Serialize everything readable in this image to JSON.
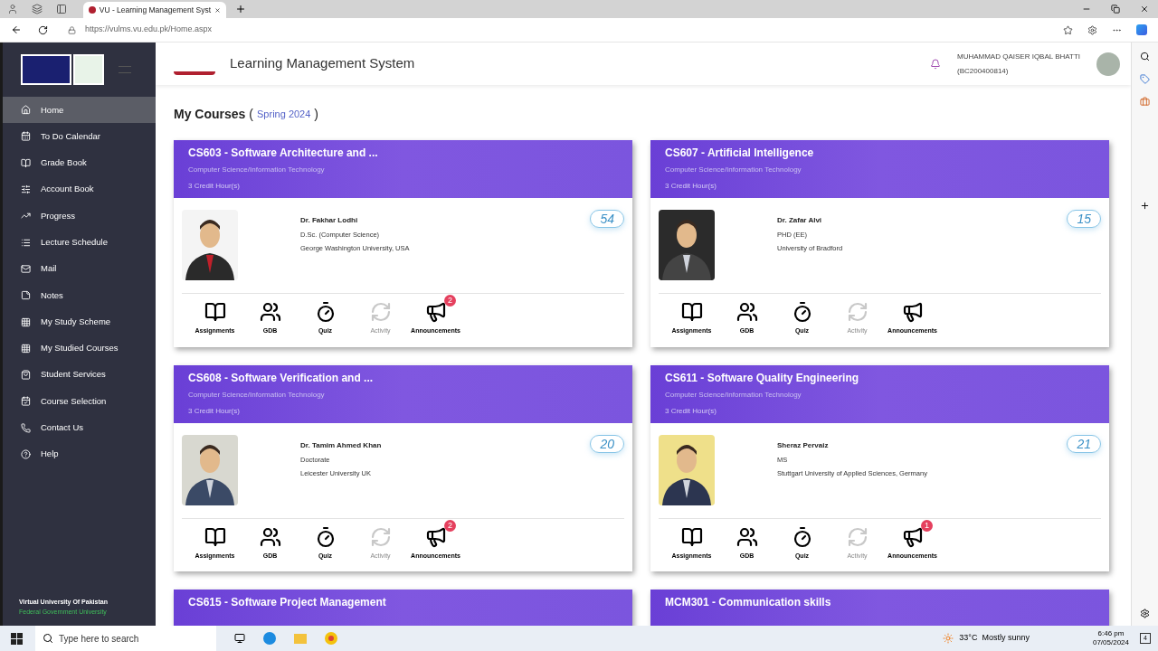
{
  "browser": {
    "tab": {
      "title": "VU - Learning Management Syst"
    },
    "url": "https://vulms.vu.edu.pk/Home.aspx"
  },
  "sidebar": {
    "items": [
      {
        "label": "Home",
        "selected": true
      },
      {
        "label": "To Do Calendar",
        "selected": false
      },
      {
        "label": "Grade Book",
        "selected": false
      },
      {
        "label": "Account Book",
        "selected": false
      },
      {
        "label": "Progress",
        "selected": false
      },
      {
        "label": "Lecture Schedule",
        "selected": false
      },
      {
        "label": "Mail",
        "selected": false
      },
      {
        "label": "Notes",
        "selected": false
      },
      {
        "label": "My Study Scheme",
        "selected": false
      },
      {
        "label": "My Studied Courses",
        "selected": false
      },
      {
        "label": "Student Services",
        "selected": false
      },
      {
        "label": "Course Selection",
        "selected": false
      },
      {
        "label": "Contact Us",
        "selected": false
      },
      {
        "label": "Help",
        "selected": false
      }
    ],
    "footer": [
      "Virtual University Of Pakistan",
      "Federal Government University"
    ]
  },
  "header": {
    "title": "Learning Management System",
    "user_name": "MUHAMMAD QAISER IQBAL BHATTI",
    "user_id": "(BC200400814)"
  },
  "page": {
    "heading": "My Courses",
    "open": "(",
    "semester": "Spring 2024",
    "close": ")"
  },
  "courses": [
    {
      "title": "CS603 - Software Architecture and ...",
      "department": "Computer Science/Information Technology",
      "credits": "3 Credit Hour(s)",
      "instructor": {
        "name": "Dr. Fakhar Lodhi",
        "degree": "D.Sc. (Computer Science)",
        "university": "George Washington University, USA"
      },
      "count": "54",
      "tools": [
        {
          "label": "Assignments",
          "disabled": false
        },
        {
          "label": "GDB",
          "disabled": false
        },
        {
          "label": "Quiz",
          "disabled": false
        },
        {
          "label": "Activity",
          "disabled": true
        },
        {
          "label": "Announcements",
          "disabled": false,
          "badge": "2"
        }
      ]
    },
    {
      "title": "CS607 - Artificial Intelligence",
      "department": "Computer Science/Information Technology",
      "credits": "3 Credit Hour(s)",
      "instructor": {
        "name": "Dr. Zafar Alvi",
        "degree": "PHD (EE)",
        "university": "University of Bradford"
      },
      "count": "15",
      "tools": [
        {
          "label": "Assignments",
          "disabled": false
        },
        {
          "label": "GDB",
          "disabled": false
        },
        {
          "label": "Quiz",
          "disabled": false
        },
        {
          "label": "Activity",
          "disabled": true
        },
        {
          "label": "Announcements",
          "disabled": false
        }
      ]
    },
    {
      "title": "CS608 - Software Verification and ...",
      "department": "Computer Science/Information Technology",
      "credits": "3 Credit Hour(s)",
      "instructor": {
        "name": "Dr. Tamim Ahmed Khan",
        "degree": "Doctorate",
        "university": "Leicester University UK"
      },
      "count": "20",
      "tools": [
        {
          "label": "Assignments",
          "disabled": false
        },
        {
          "label": "GDB",
          "disabled": false
        },
        {
          "label": "Quiz",
          "disabled": false
        },
        {
          "label": "Activity",
          "disabled": true
        },
        {
          "label": "Announcements",
          "disabled": false,
          "badge": "2"
        }
      ]
    },
    {
      "title": "CS611 - Software Quality Engineering",
      "department": "Computer Science/Information Technology",
      "credits": "3 Credit Hour(s)",
      "instructor": {
        "name": "Sheraz Pervaiz",
        "degree": "MS",
        "university": "Stuttgart University of Applied Sciences, Germany"
      },
      "count": "21",
      "tools": [
        {
          "label": "Assignments",
          "disabled": false
        },
        {
          "label": "GDB",
          "disabled": false
        },
        {
          "label": "Quiz",
          "disabled": false
        },
        {
          "label": "Activity",
          "disabled": true
        },
        {
          "label": "Announcements",
          "disabled": false,
          "badge": "1"
        }
      ]
    },
    {
      "title": "CS615 - Software Project Management"
    },
    {
      "title": "MCM301 - Communication skills"
    }
  ],
  "taskbar": {
    "search_placeholder": "Type here to search",
    "weather": "33°C  Mostly sunny",
    "time": "6:46 pm",
    "date": "07/05/2024",
    "notifications": "4"
  }
}
